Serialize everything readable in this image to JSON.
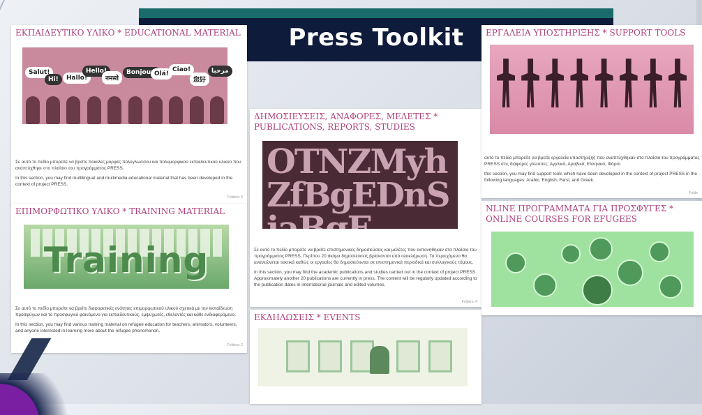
{
  "banner": {
    "title": "Press Toolkit"
  },
  "panels": {
    "educational": {
      "heading": "ΕΚΠΑΙΔΕΥΤΙΚΟ ΥΛΙΚΟ * EDUCATIONAL MATERIAL",
      "bubbles": [
        "Salut!",
        "Hi!",
        "Hallo!",
        "Hello!",
        "नमस्ते",
        "Bonjour!",
        "Olá!",
        "Ciao!",
        "您好",
        "مرحبا"
      ],
      "text_gr": "Σε αυτό το πεδίο μπορείτε να βρείτε ποικίλες μορφές πολύγλωσσου και πολυμορφικού εκπαιδευτικού υλικού που αναπτύχθηκε στο πλαίσιο του προγράμματος PRESS.",
      "text_en": "In this section, you may find multilingual and multimedia educational material that has been developed in the context of project PRESS.",
      "folders": "Folders: 5"
    },
    "training": {
      "heading": "ΕΠΙΜΟΡΦΩΤΙΚΟ ΥΛΙΚΟ * TRAINING MATERIAL",
      "image_word": "Training",
      "text_gr": "Σε αυτό το πεδίο μπορείτε να βρείτε διαφορετικές ενότητες επιμορφωτικού υλικού σχετικά με την εκπαίδευση προσφύγων και το προσφυγικό φαινόμενο για εκπαιδευτικούς, εμψυχωτές, εθελοντές και κάθε ενδιαφερόμενο.",
      "text_en": "In this section, you may find various training material on refugee education for teachers, animators, volunteers, and anyone interested in learning more about the refugee phenomenon.",
      "folders": "Folders: 2"
    },
    "publications": {
      "heading": "ΔΗΜΟΣΙΕΥΣΕΙΣ, ΑΝΑΦΟΡΕΣ, ΜΕΛΕΤΕΣ * PUBLICATIONS, REPORTS, STUDIES",
      "image_letters": "OTNZMyhZfBgEDnSiaBgE",
      "text_gr": "Σε αυτό το πεδίο μπορείτε να βρείτε επιστημονικές δημοσιεύσεις και μελέτες που εκπονήθηκαν στο πλαίσιο του προγράμματος PRESS. Περίπου 20 άκόμα δημοσιεύσεις βρίσκονται υπό ολοκλήρωση. Το περιεχόμενο θα ανανεώνεται τακτικά καθώς οι εργασίες θα δημοσιεύονται σε επιστημονικά περιοδικά και συλλογικούς τόμους.",
      "text_en": "In this section, you may find the academic publications and studies carried out in the context of project PRESS. Approximately another 20 publications are currently in press. The content will be regularly updated according to the publication dates in international journals and edited volumes.",
      "folders": "Folders: 4"
    },
    "events": {
      "heading": "ΕΚΔΗΛΩΣΕΙΣ * EVENTS"
    },
    "support": {
      "heading": "ΕΡΓΑΛΕΙΑ ΥΠΟΣΤΗΡΙΞΗΣ * SUPPORT TOOLS",
      "text_gr": "αυτό το πεδίο μπορείτε να βρείτε εργαλεία υποστήριξης που αναπτύχθηκαν στο πλαίσιο του προγράμματος PRESS στις διάφορες γλώσσες: Αγγλικά, Αραβικά, Ελληνικά, Φάρσι.",
      "text_en": "this section, you may find support tools which have been developed in the context of project PRESS in the following languages: Arabic, English, Farsi, and Greek.",
      "folders": "Folde"
    },
    "online": {
      "heading": "NLINE ΠΡΟΓΡΑΜΜΑΤΑ ΓΙΑ ΠΡΟΣΦΥΓΕΣ * ONLINE COURSES FOR EFUGEES"
    }
  },
  "colors": {
    "heading": "#b0417c",
    "banner_bg": "#0f1b3a",
    "banner_strip": "#1a6b6b"
  }
}
